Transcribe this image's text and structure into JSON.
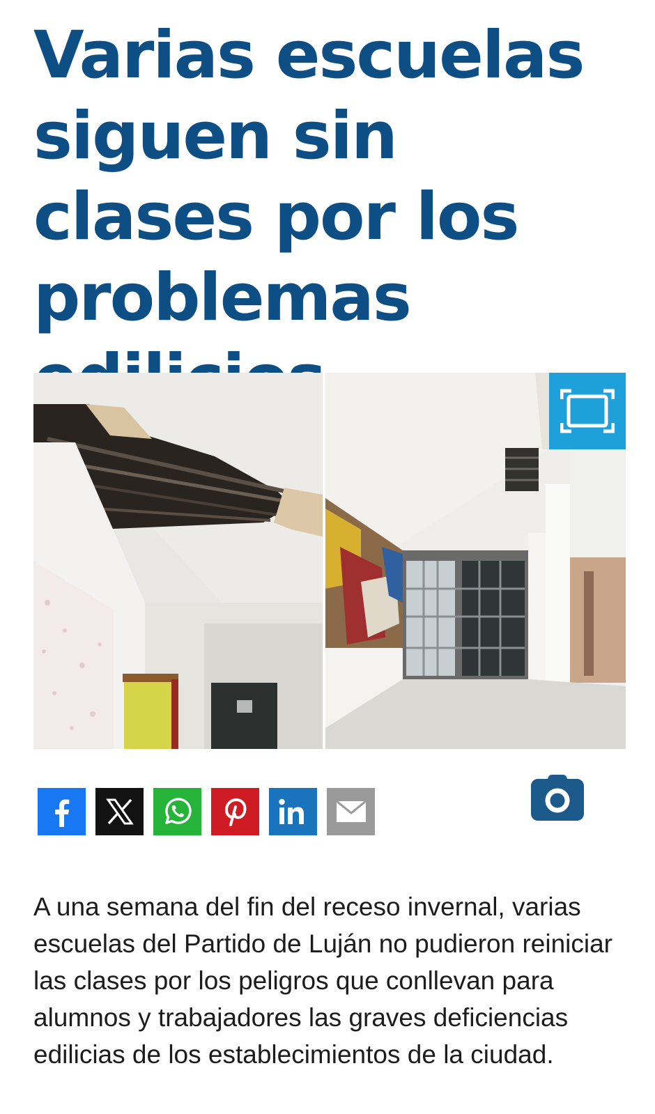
{
  "article": {
    "headline": "Varias escuelas siguen sin clases por los problemas edilicios",
    "body": "A una semana del fin del receso invernal, varias escuelas del Partido de Luján no pudieron reiniciar las clases por los peligros que conllevan para alumnos y trabajadores las graves deficiencias edilicias de los establecimientos de la ciudad."
  },
  "photo": {
    "expand_icon": "expand-icon"
  },
  "share": {
    "buttons": [
      {
        "icon": "facebook-icon",
        "color": "#1877f2"
      },
      {
        "icon": "x-icon",
        "color": "#121212"
      },
      {
        "icon": "whatsapp-icon",
        "color": "#25b33a"
      },
      {
        "icon": "pinterest-icon",
        "color": "#cf1b23"
      },
      {
        "icon": "linkedin-icon",
        "color": "#1a73bd"
      },
      {
        "icon": "email-icon",
        "color": "#9a9a9a"
      }
    ],
    "camera_icon": "camera-icon"
  },
  "colors": {
    "headline": "#0d4f85",
    "accent": "#1ea0db",
    "body_text": "#1c1c1c"
  }
}
